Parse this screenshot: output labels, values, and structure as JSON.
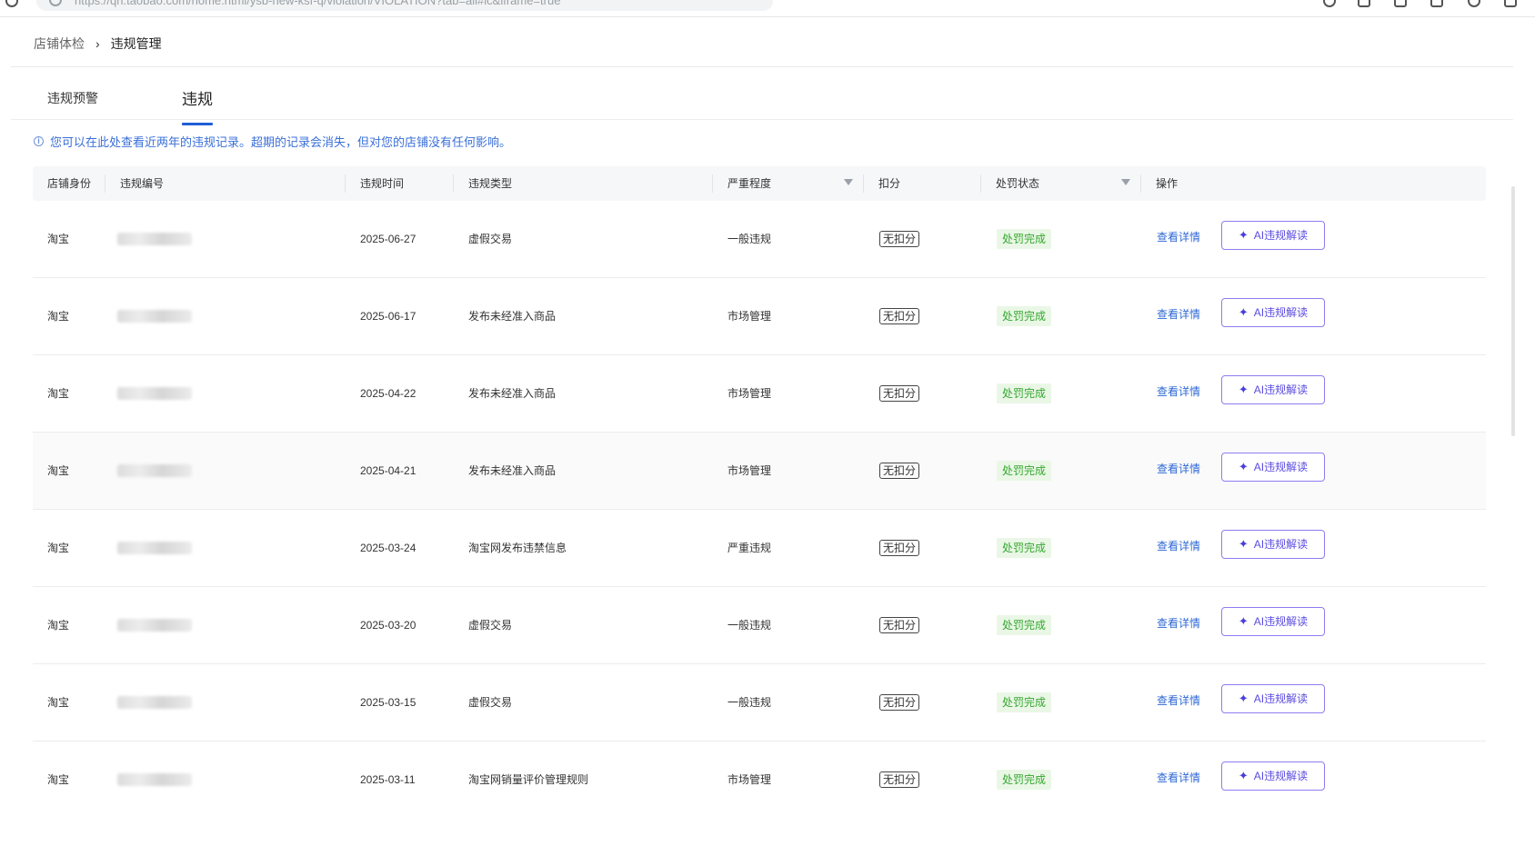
{
  "browser": {
    "url": "https://qn.taobao.com/home.html/ysb-new-ksf-q/violation/VIOLATION?tab=all#ic&iframe=true"
  },
  "breadcrumb": {
    "parent": "店铺体检",
    "separator": "›",
    "current": "违规管理"
  },
  "tabs": [
    {
      "label": "违规预警",
      "active": false
    },
    {
      "label": "违规",
      "active": true
    }
  ],
  "notice": {
    "icon": "i",
    "text": "您可以在此处查看近两年的违规记录。超期的记录会消失，但对您的店铺没有任何影响。"
  },
  "table": {
    "columns": {
      "shop": "店铺身份",
      "violation_id": "违规编号",
      "time": "违规时间",
      "type": "违规类型",
      "severity": "严重程度",
      "score": "扣分",
      "status": "处罚状态",
      "action": "操作"
    },
    "detail_label": "查看详情",
    "ai_label": "AI违规解读",
    "rows": [
      {
        "shop": "淘宝",
        "time": "2025-06-27",
        "type": "虚假交易",
        "severity": "一般违规",
        "score": "无扣分",
        "status": "处罚完成"
      },
      {
        "shop": "淘宝",
        "time": "2025-06-17",
        "type": "发布未经准入商品",
        "severity": "市场管理",
        "score": "无扣分",
        "status": "处罚完成"
      },
      {
        "shop": "淘宝",
        "time": "2025-04-22",
        "type": "发布未经准入商品",
        "severity": "市场管理",
        "score": "无扣分",
        "status": "处罚完成"
      },
      {
        "shop": "淘宝",
        "time": "2025-04-21",
        "type": "发布未经准入商品",
        "severity": "市场管理",
        "score": "无扣分",
        "status": "处罚完成"
      },
      {
        "shop": "淘宝",
        "time": "2025-03-24",
        "type": "淘宝网发布违禁信息",
        "severity": "严重违规",
        "score": "无扣分",
        "status": "处罚完成"
      },
      {
        "shop": "淘宝",
        "time": "2025-03-20",
        "type": "虚假交易",
        "severity": "一般违规",
        "score": "无扣分",
        "status": "处罚完成"
      },
      {
        "shop": "淘宝",
        "time": "2025-03-15",
        "type": "虚假交易",
        "severity": "一般违规",
        "score": "无扣分",
        "status": "处罚完成"
      },
      {
        "shop": "淘宝",
        "time": "2025-03-11",
        "type": "淘宝网销量评价管理规则",
        "severity": "市场管理",
        "score": "无扣分",
        "status": "处罚完成"
      }
    ]
  },
  "colors": {
    "link": "#2f68d6",
    "status_bg": "#eaf7e6",
    "status_text": "#34a82f",
    "ai_border": "#8f7cf0",
    "tab_underline": "#1f5fd6"
  }
}
